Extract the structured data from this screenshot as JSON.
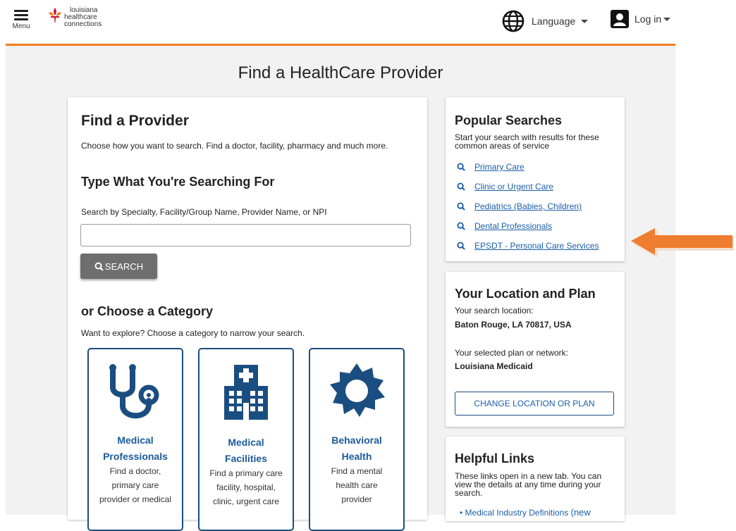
{
  "header": {
    "menu_label": "Menu",
    "logo_lines": [
      "louisiana",
      "healthcare",
      "connections"
    ],
    "language_label": "Language",
    "login_label": "Log in"
  },
  "page": {
    "title": "Find a HealthCare Provider"
  },
  "find_provider": {
    "heading": "Find a Provider",
    "intro": "Choose how you want to search. Find a doctor, facility, pharmacy and much more.",
    "search_heading": "Type What You're Searching For",
    "search_label": "Search by Specialty, Facility/Group Name, Provider Name, or NPI",
    "search_value": "",
    "search_button": "SEARCH",
    "category_heading": "or Choose a Category",
    "category_intro": "Want to explore? Choose a category to narrow your search.",
    "categories": [
      {
        "title_line1": "Medical",
        "title_line2": "Professionals",
        "desc": "Find a doctor, primary care provider or medical",
        "icon": "stethoscope-icon"
      },
      {
        "title_line1": "Medical",
        "title_line2": "Facilities",
        "desc": "Find a primary care facility, hospital, clinic, urgent care",
        "icon": "hospital-icon"
      },
      {
        "title_line1": "Behavioral",
        "title_line2": "Health",
        "desc": "Find a mental health care provider",
        "icon": "behavioral-health-icon"
      }
    ]
  },
  "popular": {
    "heading": "Popular Searches",
    "intro": "Start your search with results for these common areas of service",
    "items": [
      "Primary Care",
      "Clinic or Urgent Care",
      "Pediatrics (Babies, Children)",
      "Dental Professionals",
      "EPSDT - Personal Care Services"
    ]
  },
  "location": {
    "heading": "Your Location and Plan",
    "location_label": "Your search location:",
    "location_value": "Baton Rouge, LA 70817, USA",
    "plan_label": "Your selected plan or network:",
    "plan_value": "Louisiana Medicaid",
    "change_button": "CHANGE LOCATION OR PLAN"
  },
  "helpful": {
    "heading": "Helpful Links",
    "intro": "These links open in a new tab. You can view the details at any time during your search.",
    "link_text": "Medical Industry Definitions",
    "link_suffix": "(new"
  },
  "colors": {
    "accent_orange": "#f07c22",
    "brand_blue": "#1b4e80",
    "link_blue": "#1b5fa7"
  }
}
